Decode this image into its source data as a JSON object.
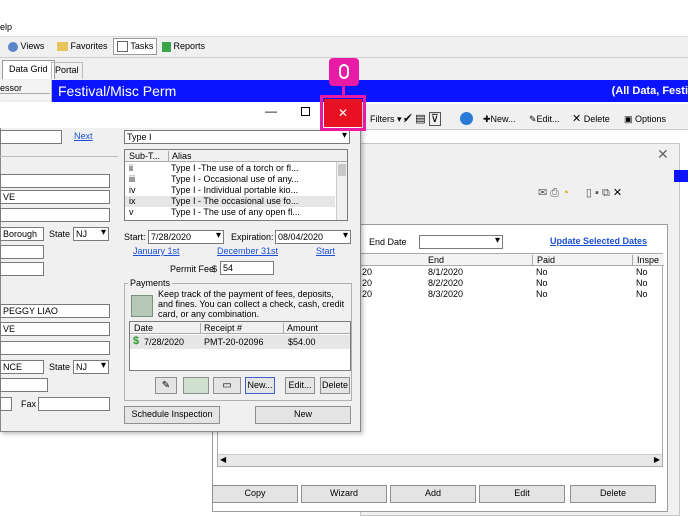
{
  "menu": {
    "help_fragment": "elp"
  },
  "toolbar1": {
    "views": "Views",
    "favorites": "Favorites",
    "tasks": "Tasks",
    "reports": "Reports"
  },
  "tabs": {
    "data_grid": "Data Grid",
    "portal": "Portal",
    "side_fragment": "essor"
  },
  "banner": {
    "title": "Festival/Misc Perm",
    "right": "(All Data, Festi"
  },
  "toolbar2": {
    "filters": "Filters",
    "new": "New...",
    "edit": "Edit...",
    "delete": "Delete",
    "options": "Options"
  },
  "dialog": {
    "next_link": "Next",
    "left_fields": [
      "VE",
      "Borough",
      "PEGGY LIAO",
      "VE",
      "NCE"
    ],
    "state_label": "State",
    "state_value": "NJ",
    "fax_label": "Fax",
    "type_value": "Type I",
    "subtype_headers": [
      "Sub-T...",
      "Alias"
    ],
    "subtypes": [
      {
        "code": "ii",
        "alias": "Type I -The use of a torch or fl..."
      },
      {
        "code": "iii",
        "alias": "Type I - Occasional use of any..."
      },
      {
        "code": "iv",
        "alias": "Type I - Individual portable kio..."
      },
      {
        "code": "ix",
        "alias": "Type I - The occasional use fo..."
      },
      {
        "code": "v",
        "alias": "Type I - The use of any open fl..."
      }
    ],
    "start_label": "Start:",
    "start_value": "7/28/2020",
    "expiration_label": "Expiration:",
    "expiration_value": "08/04/2020",
    "link_jan": "January 1st",
    "link_dec": "December 31st",
    "link_start": "Start",
    "permit_fee_label": "Permit Fee",
    "currency": "$",
    "permit_fee_value": "54",
    "payments_title": "Payments",
    "payments_desc": "Keep track of the payment of fees, deposits, and fines. You can collect a check, cash, credit card, or any combination.",
    "pay_headers": [
      "Date",
      "Receipt #",
      "Amount"
    ],
    "payments": [
      {
        "date": "7/28/2020",
        "receipt": "PMT-20-02096",
        "amount": "$54.00"
      }
    ],
    "btn_new": "New...",
    "btn_edit": "Edit...",
    "btn_delete": "Delete",
    "btn_schedule": "Schedule Inspection",
    "btn_new2": "New"
  },
  "right_panel": {
    "end_date_label": "End Date",
    "update_link": "Update Selected Dates",
    "headers": [
      "End",
      "Paid",
      "Inspe"
    ],
    "rows": [
      {
        "left": "20",
        "end": "8/1/2020",
        "paid": "No",
        "insp": "No"
      },
      {
        "left": "20",
        "end": "8/2/2020",
        "paid": "No",
        "insp": "No"
      },
      {
        "left": "20",
        "end": "8/3/2020",
        "paid": "No",
        "insp": "No"
      }
    ],
    "buttons": [
      "Copy",
      "Wizard",
      "Add",
      "Edit",
      "Delete"
    ]
  },
  "close_btn": {
    "glyph": "✕"
  },
  "colors": {
    "banner": "#0a14ff",
    "highlight": "#e81aa6",
    "close": "#e81123"
  }
}
